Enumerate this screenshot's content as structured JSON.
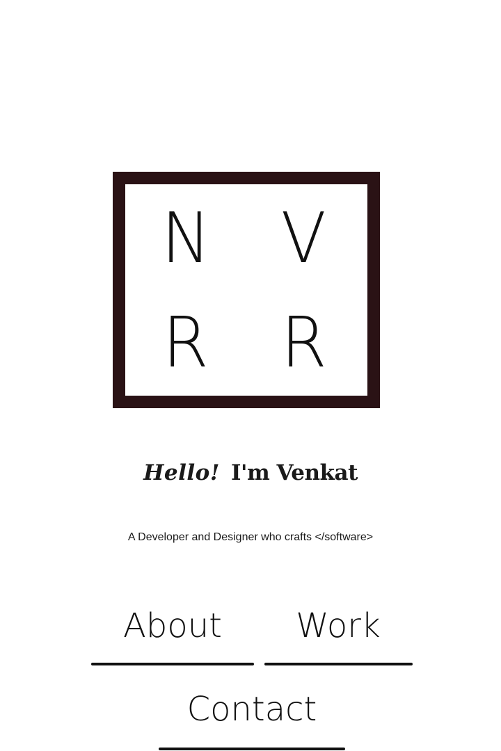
{
  "logo": {
    "letters": [
      "N",
      "V",
      "R",
      "R"
    ],
    "border_color": "#2a1215"
  },
  "greeting": {
    "hello": "Hello!",
    "intro": "I'm Venkat"
  },
  "subtitle": "A Developer and Designer who crafts </software>",
  "nav": {
    "about": "About",
    "work": "Work",
    "contact": "Contact"
  }
}
